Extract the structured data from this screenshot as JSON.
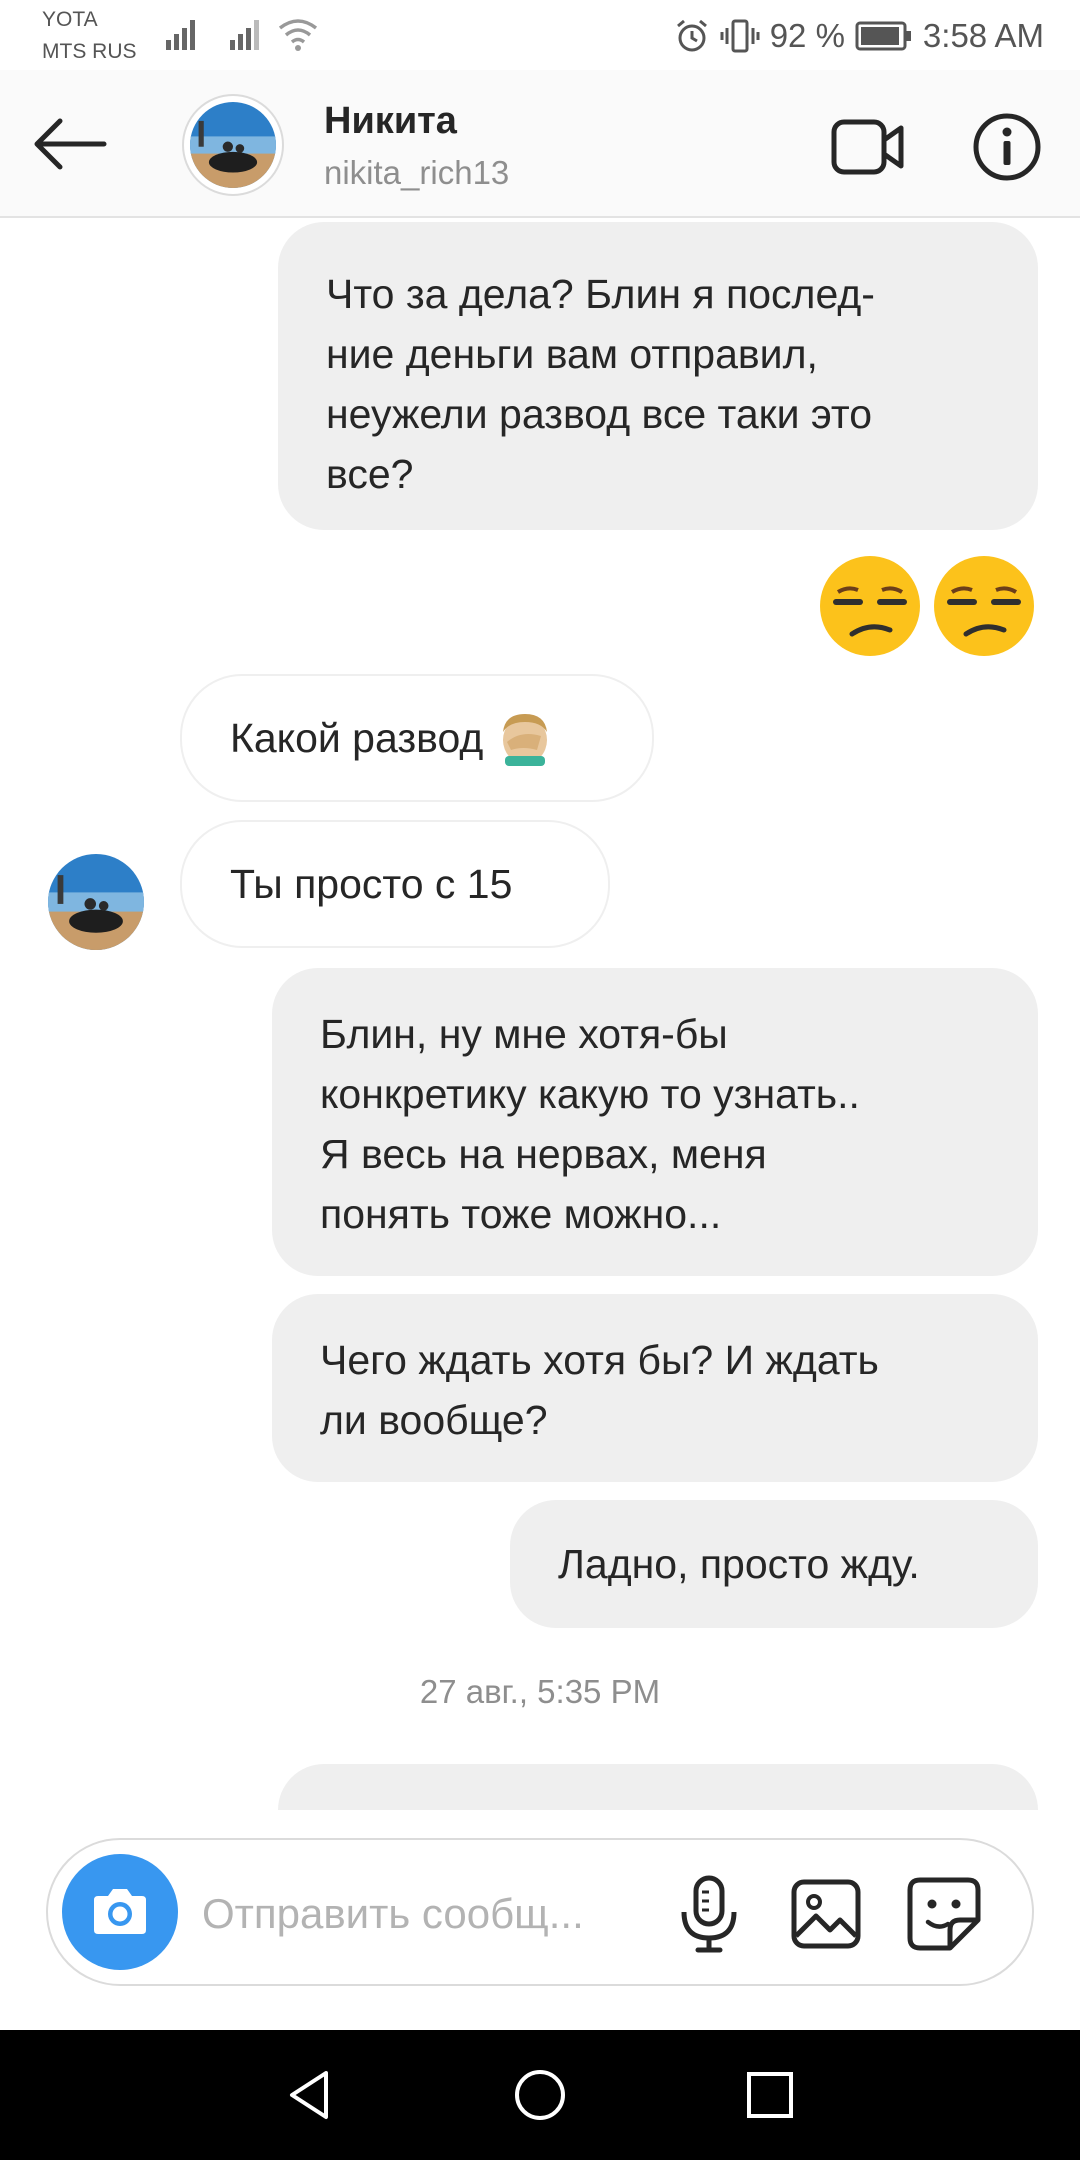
{
  "status_bar": {
    "carrier_1": "YOTA",
    "carrier_2": "MTS RUS",
    "battery": "92 %",
    "time": "3:58 AM"
  },
  "header": {
    "name": "Никита",
    "username": "nikita_rich13",
    "icons": [
      "back-arrow-icon",
      "video-call-icon",
      "info-icon"
    ]
  },
  "messages": [
    {
      "direction": "outgoing",
      "lines": [
        "Что за дела? Блин я послед-",
        "ние деньги вам отправил,",
        "неужели развод все таки это",
        "все?"
      ]
    },
    {
      "direction": "outgoing",
      "type": "emoji",
      "text": "😒😒"
    },
    {
      "direction": "incoming",
      "text": "Какой развод",
      "emoji": "🤦🏼‍♂️"
    },
    {
      "direction": "incoming",
      "text": "Ты просто с 15"
    },
    {
      "direction": "outgoing",
      "lines": [
        "Блин, ну мне хотя-бы",
        "конкретику какую то узнать..",
        "Я весь на нервах, меня",
        "понять тоже можно..."
      ]
    },
    {
      "direction": "outgoing",
      "lines": [
        "Чего ждать хотя бы? И ждать",
        "ли вообще?"
      ]
    },
    {
      "direction": "outgoing",
      "lines": [
        "Ладно, просто жду."
      ]
    }
  ],
  "timestamp": "27 авг., 5:35 PM",
  "composer": {
    "placeholder": "Отправить сообщ...",
    "icons": [
      "camera-icon",
      "microphone-icon",
      "gallery-icon",
      "sticker-icon"
    ]
  },
  "colors": {
    "accent": "#3897f0",
    "outgoing_bubble": "#efefef",
    "text": "#262626",
    "secondary_text": "#8e8e8e"
  }
}
